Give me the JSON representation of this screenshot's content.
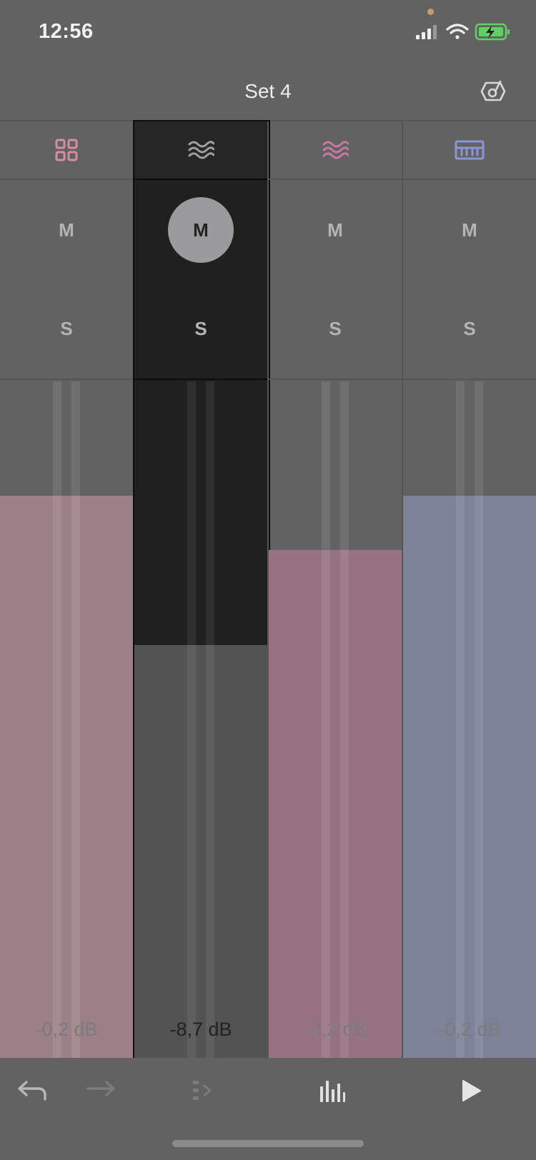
{
  "status_bar": {
    "time": "12:56",
    "privacy_dot_color": "#c99a6b",
    "battery_color": "#5fd163",
    "icons": [
      "cellular-signal-icon",
      "wifi-icon",
      "battery-charging-icon"
    ]
  },
  "header": {
    "title": "Set 4",
    "right_icon": "tuner-icon"
  },
  "tracks": [
    {
      "icon": "grid-icon",
      "icon_color": "#d48ea0",
      "mute_label": "M",
      "solo_label": "S",
      "volume": "-0,2 dB",
      "fill_color": "#9b8187",
      "level": 0.83,
      "selected": false
    },
    {
      "icon": "wave-icon",
      "icon_color": "#a0a0a0",
      "mute_label": "M",
      "solo_label": "S",
      "volume": "-8,7 dB",
      "fill_color": "#535353",
      "level": 0.61,
      "selected": true,
      "muted": true
    },
    {
      "icon": "wave-icon",
      "icon_color": "#c97aa2",
      "mute_label": "M",
      "solo_label": "S",
      "volume": "-3,2 dB",
      "fill_color": "#967283",
      "level": 0.75,
      "selected": false
    },
    {
      "icon": "keyboard-icon",
      "icon_color": "#8a95d6",
      "mute_label": "M",
      "solo_label": "S",
      "volume": "-0,2 dB",
      "fill_color": "#7e8299",
      "level": 0.83,
      "selected": false
    }
  ],
  "toolbar": {
    "icons": [
      "undo-icon",
      "redo-icon",
      "capture-icon",
      "mixer-icon",
      "play-icon"
    ]
  }
}
